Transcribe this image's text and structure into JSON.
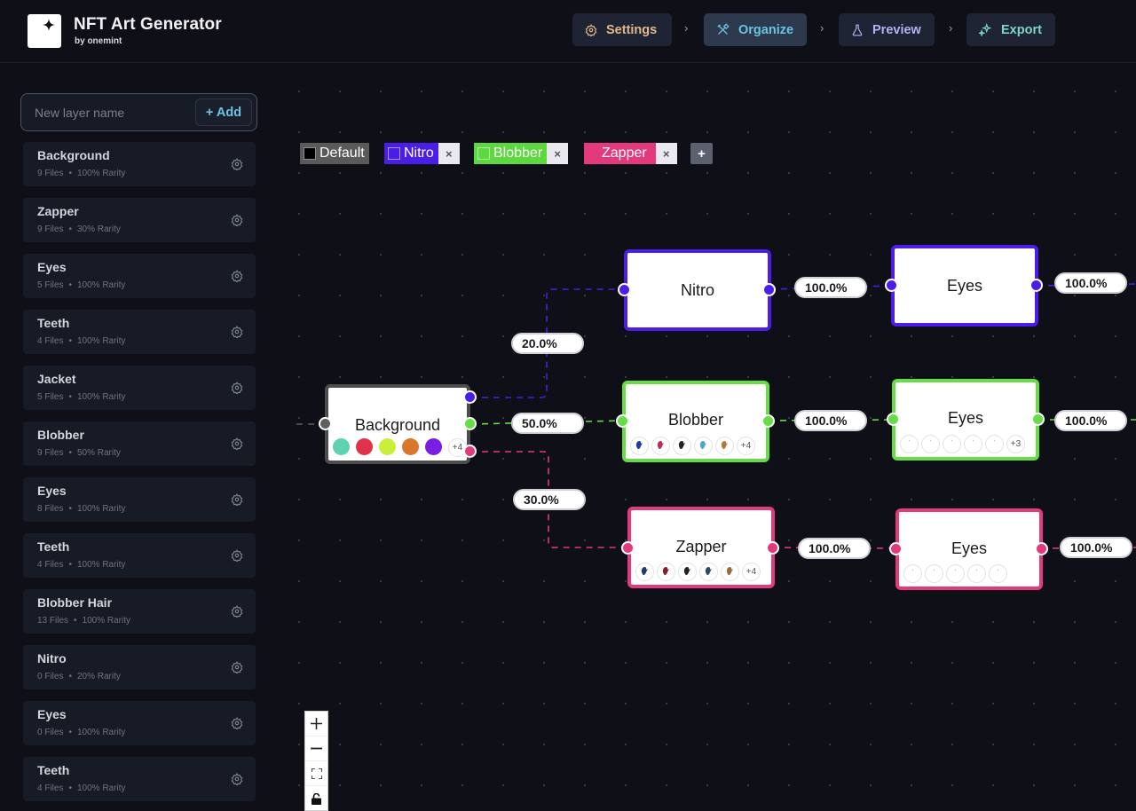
{
  "header": {
    "title": "NFT Art Generator",
    "subtitle": "by onemint",
    "logo_icon": "sparkle-icon",
    "steps": [
      {
        "label": "Settings",
        "icon": "gear-icon",
        "color": "#e3b88c",
        "active": false
      },
      {
        "label": "Organize",
        "icon": "tools-icon",
        "color": "#6cc4e4",
        "active": true
      },
      {
        "label": "Preview",
        "icon": "flask-icon",
        "color": "#b7b3f0",
        "active": false
      },
      {
        "label": "Export",
        "icon": "sparkles-icon",
        "color": "#7fd6c4",
        "active": false
      }
    ],
    "separator": "›"
  },
  "sidebar": {
    "new_layer_placeholder": "New layer name",
    "new_layer_value": "",
    "add_label": "+ Add",
    "rarity_suffix": "Rarity",
    "layers": [
      {
        "name": "Background",
        "files": "9 Files",
        "rarity": "100% Rarity"
      },
      {
        "name": "Zapper",
        "files": "9 Files",
        "rarity": "30% Rarity"
      },
      {
        "name": "Eyes",
        "files": "5 Files",
        "rarity": "100% Rarity"
      },
      {
        "name": "Teeth",
        "files": "4 Files",
        "rarity": "100% Rarity"
      },
      {
        "name": "Jacket",
        "files": "5 Files",
        "rarity": "100% Rarity"
      },
      {
        "name": "Blobber",
        "files": "9 Files",
        "rarity": "50% Rarity"
      },
      {
        "name": "Eyes",
        "files": "8 Files",
        "rarity": "100% Rarity"
      },
      {
        "name": "Teeth",
        "files": "4 Files",
        "rarity": "100% Rarity"
      },
      {
        "name": "Blobber Hair",
        "files": "13 Files",
        "rarity": "100% Rarity"
      },
      {
        "name": "Nitro",
        "files": "0 Files",
        "rarity": "20% Rarity"
      },
      {
        "name": "Eyes",
        "files": "0 Files",
        "rarity": "100% Rarity"
      },
      {
        "name": "Teeth",
        "files": "4 Files",
        "rarity": "100% Rarity"
      }
    ]
  },
  "canvas": {
    "tags": [
      {
        "label": "Default",
        "bg": "#5a5a5a",
        "swatch": "#000000",
        "removable": false
      },
      {
        "label": "Nitro",
        "bg": "#4a1ee8",
        "swatch": "#4a1ee8",
        "removable": true
      },
      {
        "label": "Blobber",
        "bg": "#5ed83f",
        "swatch": "#5ed83f",
        "removable": true
      },
      {
        "label": "Zapper",
        "bg": "#e23a7c",
        "swatch": "#e23a7c",
        "removable": true
      }
    ],
    "tag_remove_label": "×",
    "tag_add_label": "+",
    "colors": {
      "default": "#5f5f5f",
      "nitro": "#4a1ee8",
      "blobber": "#66dc46",
      "zapper": "#e23a7c"
    },
    "nodes": {
      "background": {
        "title": "Background",
        "swatches": [
          "#5fd3b0",
          "#e0334a",
          "#c9ef3c",
          "#d9782a",
          "#7a1fe0"
        ],
        "more": "+4"
      },
      "nitro": {
        "title": "Nitro"
      },
      "nitro_eyes": {
        "title": "Eyes"
      },
      "blobber": {
        "title": "Blobber",
        "thumb_colors": [
          "#1f3aa0",
          "#c02a55",
          "#222222",
          "#4aa8c9",
          "#b57a3a"
        ],
        "more": "+4"
      },
      "blobber_eyes": {
        "title": "Eyes",
        "thumb_count": 5,
        "more": "+3"
      },
      "zapper": {
        "title": "Zapper",
        "thumb_colors": [
          "#223a6a",
          "#802030",
          "#222222",
          "#2a4a6a",
          "#9a6a3a"
        ],
        "more": "+4"
      },
      "zapper_eyes": {
        "title": "Eyes",
        "thumb_count": 5
      }
    },
    "edge_labels": {
      "bg_nitro": "20.0%",
      "bg_blobber": "50.0%",
      "bg_zapper": "30.0%",
      "nitro_eyes": "100.0%",
      "nitro_eyes_out": "100.0%",
      "blobber_eyes": "100.0%",
      "blobber_eyes_out": "100.0%",
      "zapper_eyes": "100.0%",
      "zapper_eyes_out": "100.0%"
    },
    "zoom_controls": [
      {
        "name": "zoom-in-button",
        "icon": "plus-icon"
      },
      {
        "name": "zoom-out-button",
        "icon": "minus-icon"
      },
      {
        "name": "fit-view-button",
        "icon": "fit-view-icon"
      },
      {
        "name": "lock-button",
        "icon": "unlock-icon"
      }
    ]
  }
}
